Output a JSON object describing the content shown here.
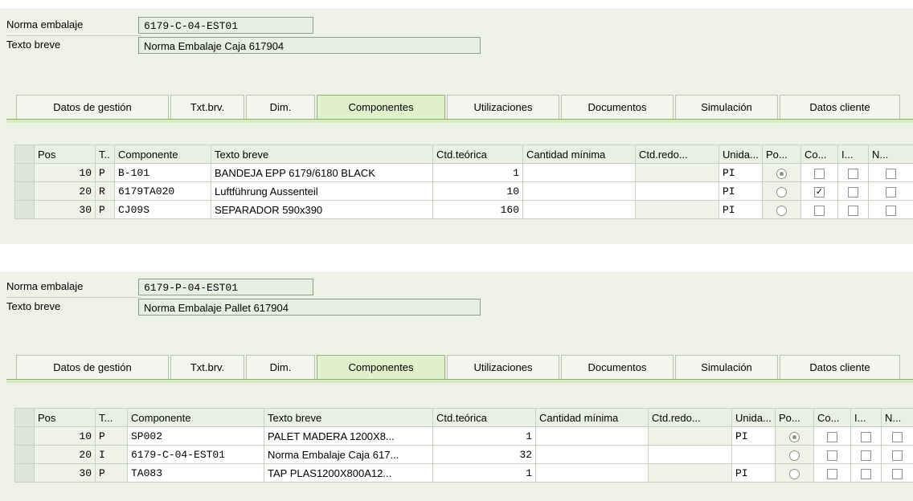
{
  "section1": {
    "norma_label": "Norma embalaje",
    "norma_value": "6179-C-04-EST01",
    "texto_label": "Texto breve",
    "texto_value": "Norma Embalaje Caja 617904",
    "tabs": [
      "Datos de gestión",
      "Txt.brv.",
      "Dim.",
      "Componentes",
      "Utilizaciones",
      "Documentos",
      "Simulación",
      "Datos cliente"
    ],
    "active_tab": "Componentes",
    "columns": [
      "Pos",
      "T..",
      "Componente",
      "Texto breve",
      "Ctd.teórica",
      "Cantidad mínima",
      "Ctd.redo...",
      "Unida...",
      "Po...",
      "Co...",
      "I...",
      "N..."
    ],
    "rows": [
      {
        "pos": "10",
        "t": "P",
        "comp": "B-101",
        "texto": "BANDEJA EPP 6179/6180 BLACK",
        "ctd": "1",
        "min": "",
        "redo": "",
        "unid": "PI",
        "po": true,
        "co": false
      },
      {
        "pos": "20",
        "t": "R",
        "comp": "6179TA020",
        "texto": "Luftführung Aussenteil",
        "ctd": "10",
        "min": "",
        "redo": "",
        "unid": "PI",
        "po": false,
        "co": true
      },
      {
        "pos": "30",
        "t": "P",
        "comp": "CJ09S",
        "texto": "SEPARADOR 590x390",
        "ctd": "160",
        "min": "",
        "redo": "",
        "unid": "PI",
        "po": false,
        "co": false
      }
    ]
  },
  "section2": {
    "norma_label": "Norma embalaje",
    "norma_value": "6179-P-04-EST01",
    "texto_label": "Texto breve",
    "texto_value": "Norma Embalaje Pallet 617904",
    "tabs": [
      "Datos de gestión",
      "Txt.brv.",
      "Dim.",
      "Componentes",
      "Utilizaciones",
      "Documentos",
      "Simulación",
      "Datos cliente"
    ],
    "active_tab": "Componentes",
    "columns": [
      "Pos",
      "T...",
      "Componente",
      "Texto breve",
      "Ctd.teórica",
      "Cantidad mínima",
      "Ctd.redo...",
      "Unida...",
      "Po...",
      "Co...",
      "I...",
      "N..."
    ],
    "rows": [
      {
        "pos": "10",
        "t": "P",
        "comp": "SP002",
        "texto": "PALET MADERA 1200X8...",
        "ctd": "1",
        "min": "",
        "redo": "",
        "unid": "PI",
        "po": true,
        "co": false
      },
      {
        "pos": "20",
        "t": "I",
        "comp": "6179-C-04-EST01",
        "texto": "Norma Embalaje Caja 617...",
        "ctd": "32",
        "min": "",
        "redo": "",
        "unid": "",
        "po": false,
        "co": false
      },
      {
        "pos": "30",
        "t": "P",
        "comp": "TA083",
        "texto": "TAP PLAS1200X800A12...",
        "ctd": "1",
        "min": "",
        "redo": "",
        "unid": "PI",
        "po": false,
        "co": false
      }
    ]
  }
}
